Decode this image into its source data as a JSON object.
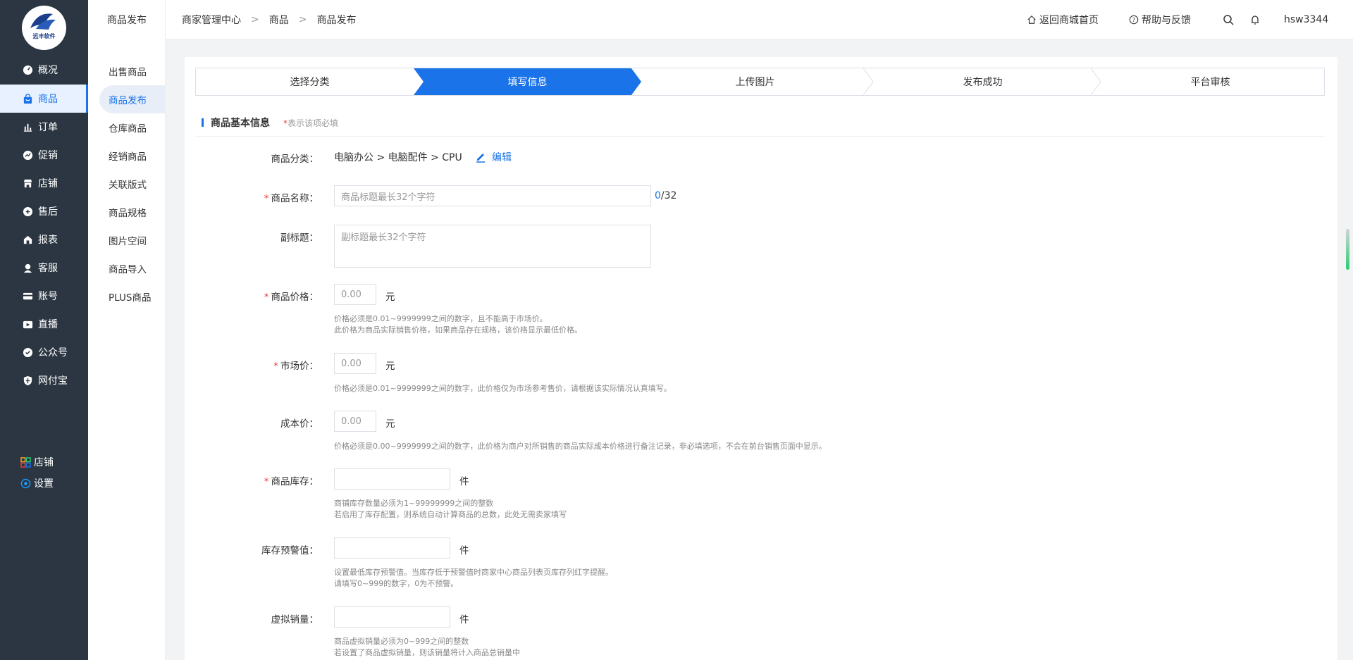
{
  "sidebar": {
    "logo_text": "远丰软件",
    "items": [
      {
        "label": "概况",
        "icon": "gauge-icon"
      },
      {
        "label": "商品",
        "icon": "bag-icon"
      },
      {
        "label": "订单",
        "icon": "bar-chart-icon"
      },
      {
        "label": "促销",
        "icon": "promo-icon"
      },
      {
        "label": "店铺",
        "icon": "store-icon"
      },
      {
        "label": "售后",
        "icon": "aftersale-icon"
      },
      {
        "label": "报表",
        "icon": "report-icon"
      },
      {
        "label": "客服",
        "icon": "service-icon"
      },
      {
        "label": "账号",
        "icon": "card-icon"
      },
      {
        "label": "直播",
        "icon": "live-icon"
      },
      {
        "label": "公众号",
        "icon": "shield-check-icon"
      },
      {
        "label": "网付宝",
        "icon": "shield-icon"
      }
    ],
    "bottom": [
      {
        "label": "店铺",
        "icon": "grid-icon"
      },
      {
        "label": "设置",
        "icon": "settings-icon"
      }
    ]
  },
  "submenu": {
    "title": "商品发布",
    "items": [
      "出售商品",
      "商品发布",
      "仓库商品",
      "经销商品",
      "关联版式",
      "商品规格",
      "图片空间",
      "商品导入",
      "PLUS商品"
    ]
  },
  "header": {
    "breadcrumb": [
      "商家管理中心",
      "商品",
      "商品发布"
    ],
    "home_link": "返回商城首页",
    "help_link": "帮助与反馈",
    "username": "hsw3344"
  },
  "steps": [
    "选择分类",
    "填写信息",
    "上传图片",
    "发布成功",
    "平台审核"
  ],
  "section": {
    "title": "商品基本信息",
    "note_star": "*",
    "note": "表示该项必填"
  },
  "form": {
    "category_label": "商品分类：",
    "category_value": "电脑办公 > 电脑配件 > CPU",
    "edit_label": "编辑",
    "name_label": "商品名称：",
    "name_placeholder": "商品标题最长32个字符",
    "name_count_current": "0",
    "name_count_max": "/32",
    "subtitle_label": "副标题：",
    "subtitle_placeholder": "副标题最长32个字符",
    "price_label": "商品价格：",
    "price_value": "0.00",
    "price_unit": "元",
    "price_hint_1": "价格必须是0.01~9999999之间的数字，且不能高于市场价。",
    "price_hint_2": "此价格为商品实际销售价格，如果商品存在规格，该价格显示最低价格。",
    "market_label": "市场价：",
    "market_value": "0.00",
    "market_unit": "元",
    "market_hint": "价格必须是0.01~9999999之间的数字，此价格仅为市场参考售价，请根据该实际情况认真填写。",
    "cost_label": "成本价：",
    "cost_value": "0.00",
    "cost_unit": "元",
    "cost_hint": "价格必须是0.00~9999999之间的数字，此价格为商户对所销售的商品实际成本价格进行备注记录，非必填选项，不会在前台销售页面中显示。",
    "stock_label": "商品库存：",
    "stock_unit": "件",
    "stock_hint_1": "商铺库存数量必须为1~99999999之间的整数",
    "stock_hint_2": "若启用了库存配置，则系统自动计算商品的总数，此处无需卖家填写",
    "warn_label": "库存预警值：",
    "warn_unit": "件",
    "warn_hint_1": "设置最低库存预警值。当库存低于预警值时商家中心商品列表页库存列红字提醒。",
    "warn_hint_2": "请填写0~999的数字，0为不预警。",
    "virtual_label": "虚拟销量：",
    "virtual_unit": "件",
    "virtual_hint_1": "商品虚拟销量必须为0~999之间的整数",
    "virtual_hint_2": "若设置了商品虚拟销量，则该销量将计入商品总销量中"
  },
  "colors": {
    "primary": "#1a73e8",
    "sidebar": "#2b3642",
    "required": "#e64340"
  }
}
